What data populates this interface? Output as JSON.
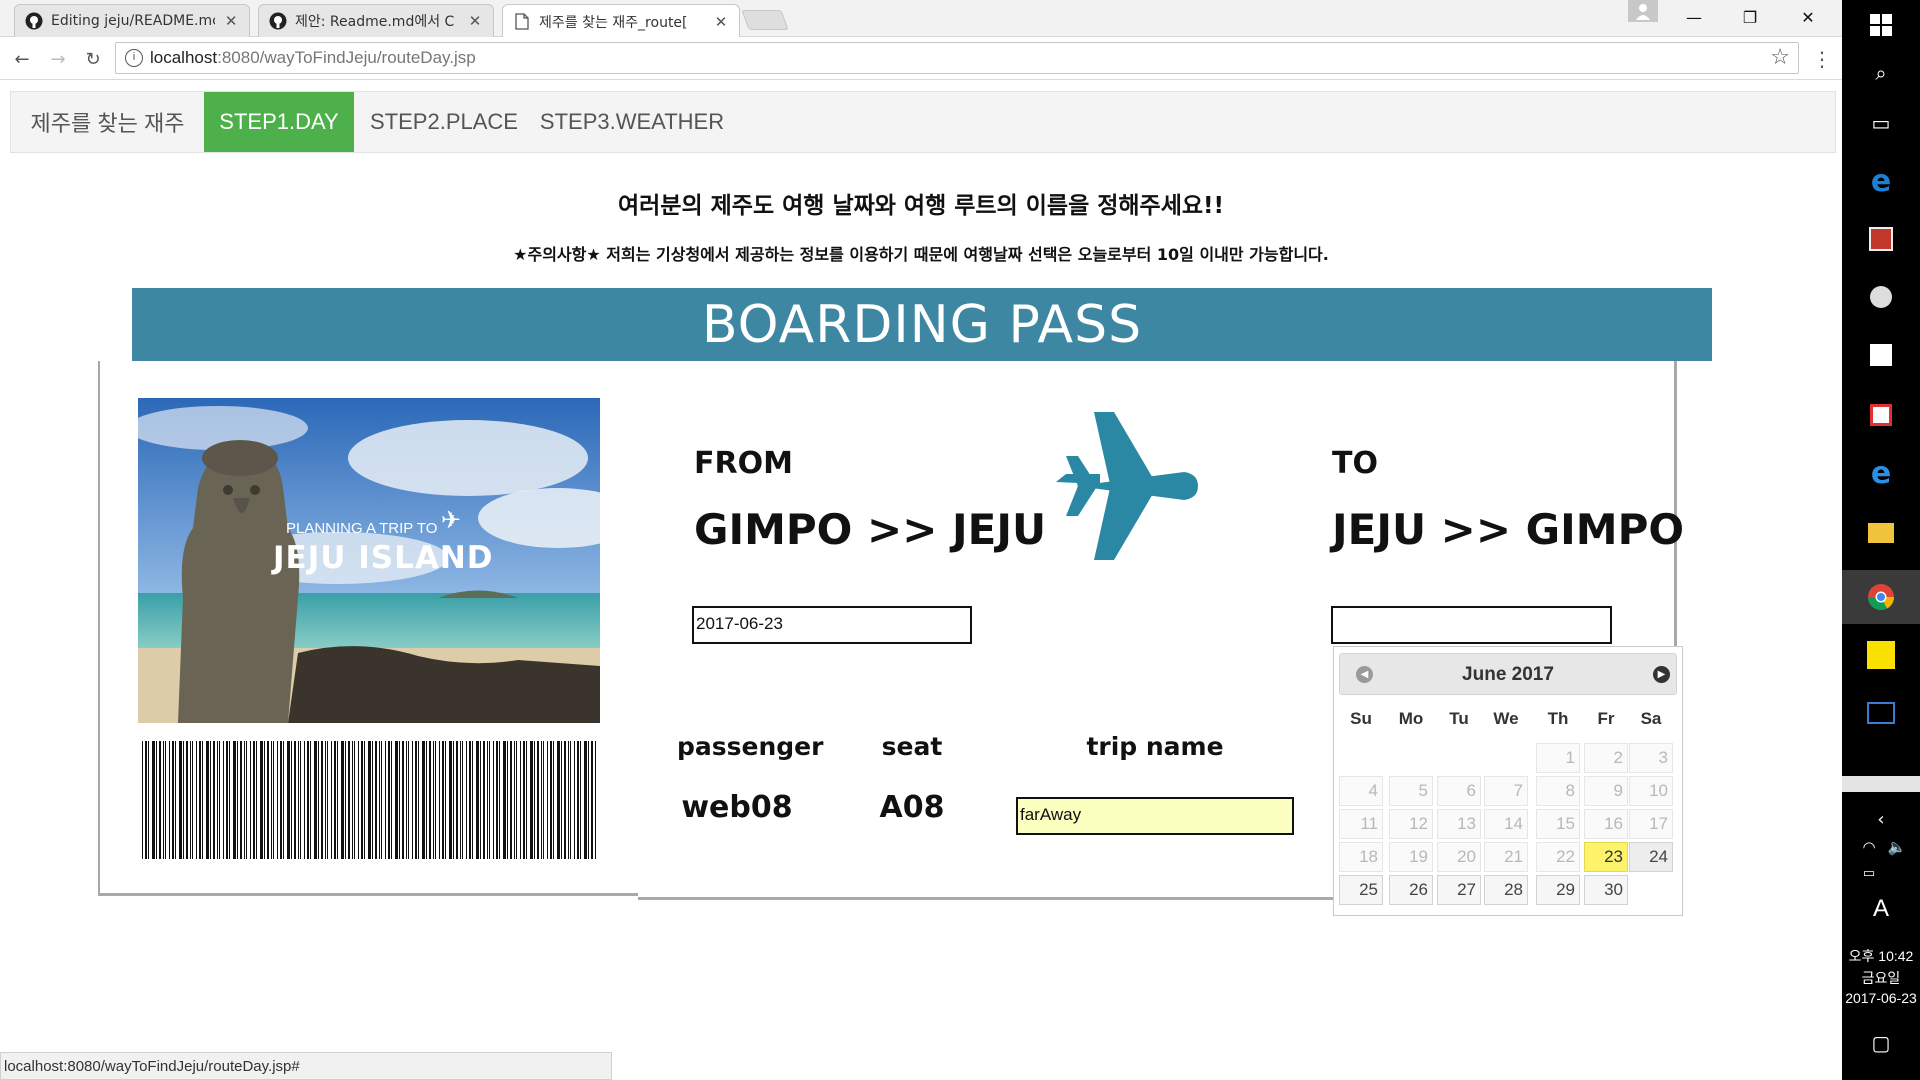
{
  "browser": {
    "tabs": [
      {
        "title": "Editing jeju/README.mc",
        "icon": "github-icon"
      },
      {
        "title": "제안: Readme.md에서 C",
        "icon": "github-icon"
      },
      {
        "title": "제주를 찾는 재주_route[",
        "icon": "page-icon"
      }
    ],
    "url_host": "localhost",
    "url_rest": ":8080/wayToFindJeju/routeDay.jsp",
    "status_url": "localhost:8080/wayToFindJeju/routeDay.jsp#"
  },
  "nav": {
    "brand": "제주를 찾는 재주",
    "items": [
      "STEP1.DAY",
      "STEP2.PLACE",
      "STEP3.WEATHER"
    ],
    "active": "STEP1.DAY",
    "active_color": "#4db04b"
  },
  "intro": {
    "title": "여러분의 제주도 여행 날짜와 여행 루트의 이름을 정해주세요!!",
    "notice": "★주의사항★ 저희는 기상청에서 제공하는 정보를 이용하기 때문에 여행날짜 선택은 오늘로부터 10일 이내만 가능합니다."
  },
  "pass": {
    "header": "BOARDING PASS",
    "header_color": "#3d87a2",
    "photo_text_small": "PLANNING A TRIP TO",
    "photo_text_big": "JEJU ISLAND",
    "from_label": "FROM",
    "from_route": "GIMPO >> JEJU",
    "to_label": "TO",
    "to_route": "JEJU >> GIMPO",
    "from_date": "2017-06-23",
    "to_date": "",
    "passenger_label": "passenger",
    "passenger_value": "web08",
    "seat_label": "seat",
    "seat_value": "A08",
    "trip_label": "trip name",
    "trip_value": "farAway"
  },
  "datepicker": {
    "title": "June 2017",
    "weekdays": [
      "Su",
      "Mo",
      "Tu",
      "We",
      "Th",
      "Fr",
      "Sa"
    ],
    "weeks": [
      [
        "",
        "",
        "",
        "",
        "1",
        "2",
        "3"
      ],
      [
        "4",
        "5",
        "6",
        "7",
        "8",
        "9",
        "10"
      ],
      [
        "11",
        "12",
        "13",
        "14",
        "15",
        "16",
        "17"
      ],
      [
        "18",
        "19",
        "20",
        "21",
        "22",
        "23",
        "24"
      ],
      [
        "25",
        "26",
        "27",
        "28",
        "29",
        "30",
        ""
      ]
    ],
    "selected_day": "23"
  },
  "taskbar": {
    "time_line1": "오후 10:42",
    "time_line2": "금요일",
    "time_line3": "2017-06-23",
    "ime": "A"
  }
}
